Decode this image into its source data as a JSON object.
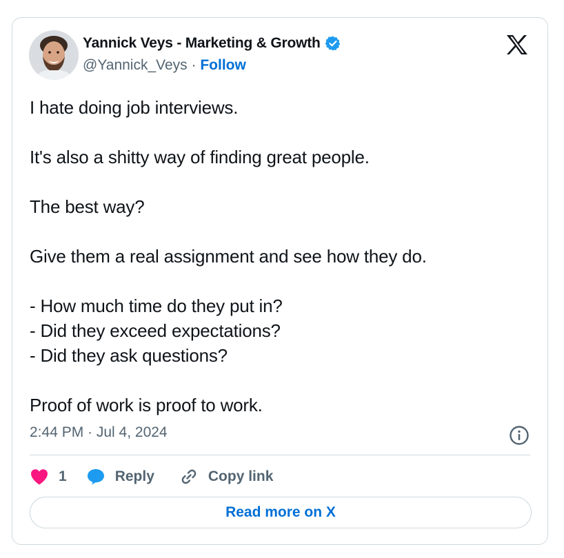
{
  "author": {
    "name": "Yannick Veys - Marketing & Growth",
    "handle": "@Yannick_Veys",
    "separator": " · ",
    "follow_label": "Follow",
    "verified": true,
    "avatar_icon": "user-avatar"
  },
  "platform": {
    "logo_icon": "x-logo-icon"
  },
  "tweet": {
    "text": "I hate doing job interviews.\n\nIt's also a shitty way of finding great people.\n\nThe best way?\n\nGive them a real assignment and see how they do.\n\n- How much time do they put in?\n- Did they exceed expectations?\n- Did they ask questions?\n\nProof of work is proof to work.",
    "timestamp": "2:44 PM · Jul 4, 2024"
  },
  "actions": {
    "like_count": "1",
    "reply_label": "Reply",
    "copy_link_label": "Copy link",
    "read_more_label": "Read more on X"
  },
  "colors": {
    "accent": "#006fd6",
    "like": "#f91880",
    "reply": "#1d9bf0",
    "muted": "#536471",
    "border": "#cfd9de"
  }
}
